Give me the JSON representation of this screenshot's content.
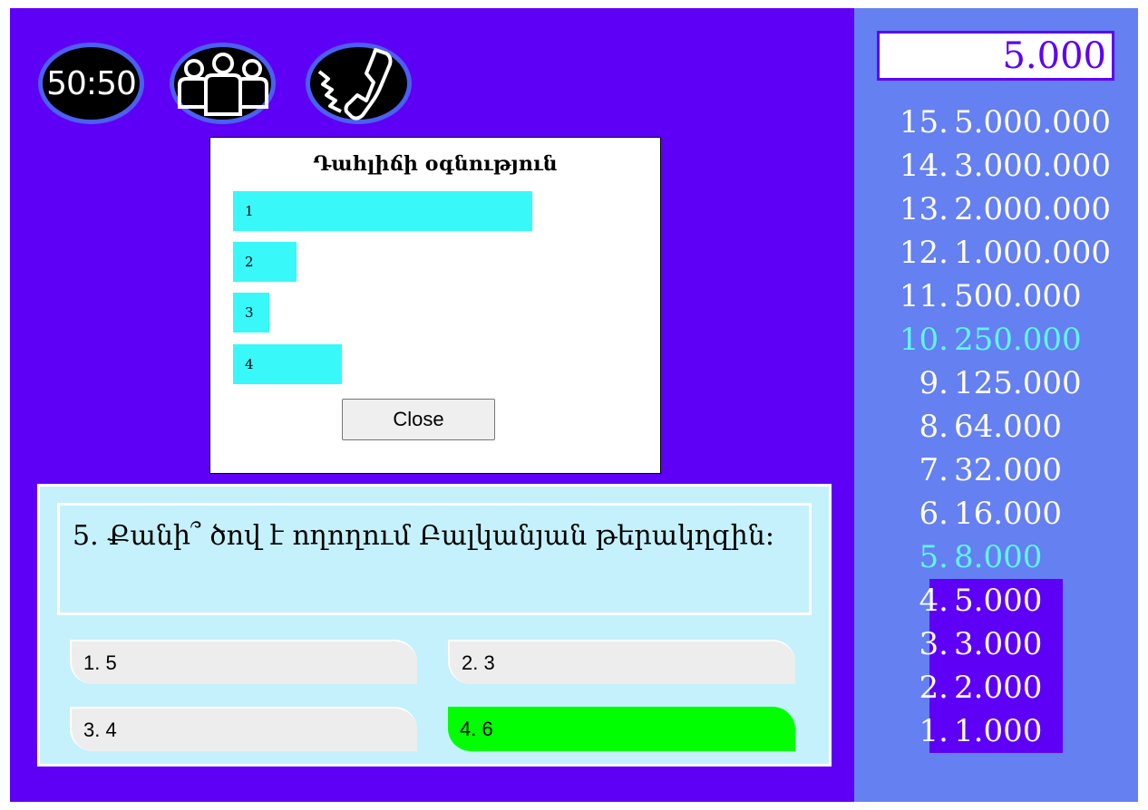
{
  "lifelines": {
    "fifty_fifty": "50:50",
    "audience_icon": "audience-icon",
    "phone_icon": "phone-icon"
  },
  "dialog": {
    "title": "Դահլիճի օգնություն",
    "close_label": "Close",
    "bars": [
      {
        "label": "1",
        "value": 0.66
      },
      {
        "label": "2",
        "value": 0.14
      },
      {
        "label": "3",
        "value": 0.08
      },
      {
        "label": "4",
        "value": 0.24
      }
    ]
  },
  "question": {
    "text": "5. Քանի՞ ծով է ողողում Բալկանյան թերակղզին:",
    "answers": [
      {
        "label": "1. 5",
        "correct": false
      },
      {
        "label": "2. 3",
        "correct": false
      },
      {
        "label": "3. 4",
        "correct": false
      },
      {
        "label": "4. 6",
        "correct": true
      }
    ]
  },
  "money": {
    "current": "5.000",
    "ladder": [
      {
        "num": "15.",
        "amount": "5.000.000",
        "milestone": false
      },
      {
        "num": "14.",
        "amount": "3.000.000",
        "milestone": false
      },
      {
        "num": "13.",
        "amount": "2.000.000",
        "milestone": false
      },
      {
        "num": "12.",
        "amount": "1.000.000",
        "milestone": false
      },
      {
        "num": "11.",
        "amount": "500.000",
        "milestone": false
      },
      {
        "num": "10.",
        "amount": "250.000",
        "milestone": true
      },
      {
        "num": "9.",
        "amount": "125.000",
        "milestone": false
      },
      {
        "num": "8.",
        "amount": "64.000",
        "milestone": false
      },
      {
        "num": "7.",
        "amount": "32.000",
        "milestone": false
      },
      {
        "num": "6.",
        "amount": "16.000",
        "milestone": false
      },
      {
        "num": "5.",
        "amount": "8.000",
        "milestone": true
      },
      {
        "num": "4.",
        "amount": "5.000",
        "milestone": false
      },
      {
        "num": "3.",
        "amount": "3.000",
        "milestone": false
      },
      {
        "num": "2.",
        "amount": "2.000",
        "milestone": false
      },
      {
        "num": "1.",
        "amount": "1.000",
        "milestone": false
      }
    ]
  },
  "colors": {
    "game_bg": "#5e00f6",
    "sidebar_bg": "#6580f0",
    "bar": "#38f8fa",
    "milestone": "#5ff6fc",
    "correct_answer": "#00ff00"
  }
}
